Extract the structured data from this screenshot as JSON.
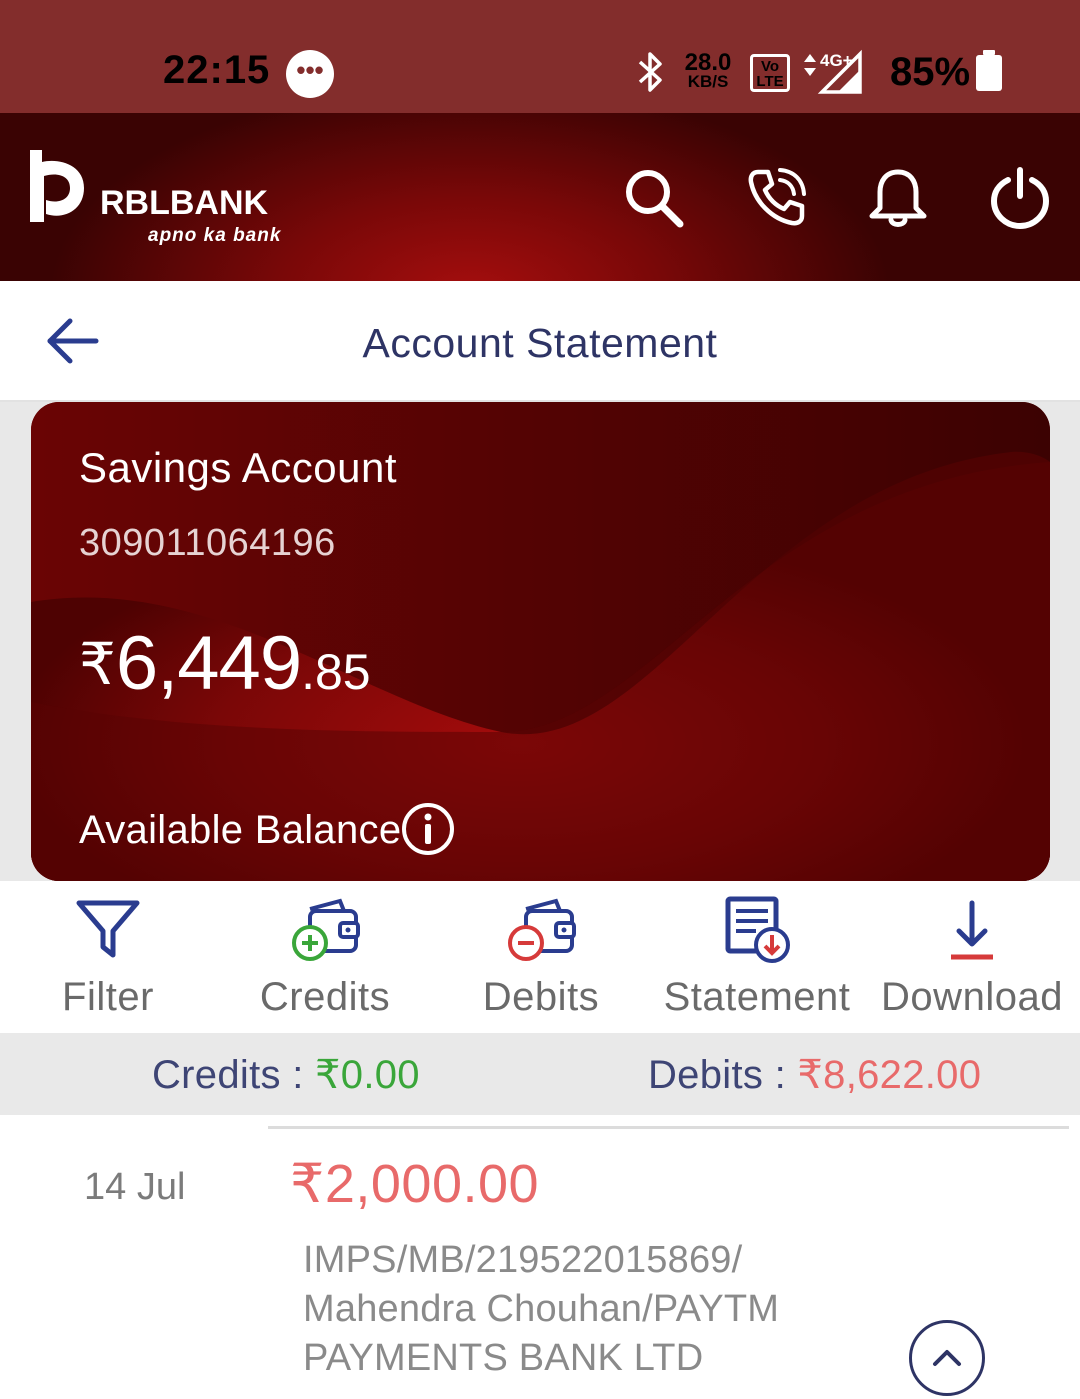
{
  "status_bar": {
    "time": "22:15",
    "speed_value": "28.0",
    "speed_unit": "KB/S",
    "volte": "Vo LTE",
    "network": "4G+",
    "battery": "85%",
    "icons": [
      "message-icon",
      "bluetooth-icon",
      "signal-icon",
      "battery-icon"
    ]
  },
  "header": {
    "brand": "RBLBANK",
    "tagline": "apno ka bank",
    "icons": [
      "search-icon",
      "call-icon",
      "bell-icon",
      "power-icon"
    ]
  },
  "title_bar": {
    "title": "Account Statement"
  },
  "account": {
    "type": "Savings Account",
    "number": "309011064196",
    "currency": "₹",
    "balance_main": "6,449",
    "balance_decimal": ".85",
    "balance_label": "Available Balance"
  },
  "actions": [
    {
      "label": "Filter",
      "icon": "filter-icon"
    },
    {
      "label": "Credits",
      "icon": "wallet-plus-icon"
    },
    {
      "label": "Debits",
      "icon": "wallet-minus-icon"
    },
    {
      "label": "Statement",
      "icon": "statement-icon"
    },
    {
      "label": "Download",
      "icon": "download-icon"
    }
  ],
  "summary": {
    "credits_label": "Credits : ",
    "credits_value": "₹0.00",
    "debits_label": "Debits : ",
    "debits_value": "₹8,622.00"
  },
  "transactions": [
    {
      "date": "14 Jul",
      "amount": "₹2,000.00",
      "description_lines": [
        "IMPS/MB/219522015869/",
        "Mahendra Chouhan/PAYTM",
        "PAYMENTS BANK LTD"
      ]
    }
  ],
  "colors": {
    "status_bar": "#832d2c",
    "header_dark": "#3a0303",
    "header_glow": "#a50e0e",
    "card": "#6c0404",
    "title_text": "#2e3465",
    "credit_green": "#3aa63a",
    "debit_red": "#e86a6a",
    "icon_blue": "#2a3c8f"
  }
}
